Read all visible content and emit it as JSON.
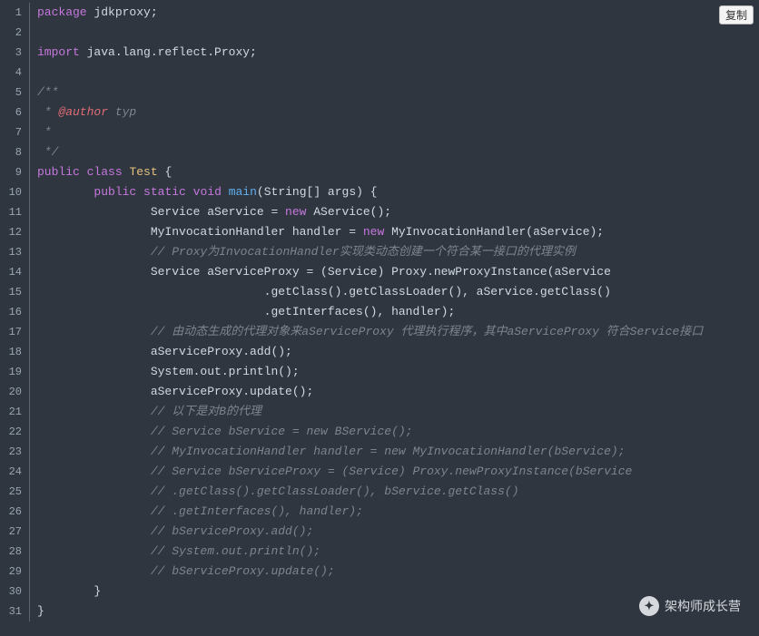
{
  "copy_button": "复制",
  "watermark": {
    "icon_glyph": "✦",
    "text": "架构师成长营"
  },
  "lines": [
    {
      "n": 1,
      "segs": [
        [
          "kw",
          "package"
        ],
        [
          "",
          " jdkproxy;"
        ]
      ]
    },
    {
      "n": 2,
      "segs": [
        [
          "",
          ""
        ]
      ]
    },
    {
      "n": 3,
      "segs": [
        [
          "kw",
          "import"
        ],
        [
          "",
          " java.lang.reflect.Proxy;"
        ]
      ]
    },
    {
      "n": 4,
      "segs": [
        [
          "",
          ""
        ]
      ]
    },
    {
      "n": 5,
      "segs": [
        [
          "com",
          "/**"
        ]
      ]
    },
    {
      "n": 6,
      "segs": [
        [
          "com",
          " * "
        ],
        [
          "tag",
          "@author"
        ],
        [
          "authv",
          " typ"
        ]
      ]
    },
    {
      "n": 7,
      "segs": [
        [
          "com",
          " *"
        ]
      ]
    },
    {
      "n": 8,
      "segs": [
        [
          "com",
          " */"
        ]
      ]
    },
    {
      "n": 9,
      "segs": [
        [
          "kw",
          "public"
        ],
        [
          "",
          " "
        ],
        [
          "kw",
          "class"
        ],
        [
          "",
          " "
        ],
        [
          "cls",
          "Test"
        ],
        [
          "",
          " {"
        ]
      ]
    },
    {
      "n": 10,
      "segs": [
        [
          "",
          "        "
        ],
        [
          "kw",
          "public"
        ],
        [
          "",
          " "
        ],
        [
          "kw",
          "static"
        ],
        [
          "",
          " "
        ],
        [
          "kw",
          "void"
        ],
        [
          "",
          " "
        ],
        [
          "fnname",
          "main"
        ],
        [
          "",
          "(String[] args) {"
        ]
      ]
    },
    {
      "n": 11,
      "segs": [
        [
          "",
          "                Service aService = "
        ],
        [
          "nw",
          "new"
        ],
        [
          "",
          " AService();"
        ]
      ]
    },
    {
      "n": 12,
      "segs": [
        [
          "",
          "                MyInvocationHandler handler = "
        ],
        [
          "nw",
          "new"
        ],
        [
          "",
          " MyInvocationHandler(aService);"
        ]
      ]
    },
    {
      "n": 13,
      "segs": [
        [
          "",
          "                "
        ],
        [
          "com",
          "// Proxy为InvocationHandler实现类动态创建一个符合某一接口的代理实例"
        ]
      ]
    },
    {
      "n": 14,
      "segs": [
        [
          "",
          "                Service aServiceProxy = (Service) Proxy.newProxyInstance(aService"
        ]
      ]
    },
    {
      "n": 15,
      "segs": [
        [
          "",
          "                                .getClass().getClassLoader(), aService.getClass()"
        ]
      ]
    },
    {
      "n": 16,
      "segs": [
        [
          "",
          "                                .getInterfaces(), handler);"
        ]
      ]
    },
    {
      "n": 17,
      "segs": [
        [
          "",
          "                "
        ],
        [
          "com",
          "// 由动态生成的代理对象来aServiceProxy 代理执行程序，其中aServiceProxy 符合Service接口"
        ]
      ]
    },
    {
      "n": 18,
      "segs": [
        [
          "",
          "                aServiceProxy.add();"
        ]
      ]
    },
    {
      "n": 19,
      "segs": [
        [
          "",
          "                System.out.println();"
        ]
      ]
    },
    {
      "n": 20,
      "segs": [
        [
          "",
          "                aServiceProxy.update();"
        ]
      ]
    },
    {
      "n": 21,
      "segs": [
        [
          "",
          "                "
        ],
        [
          "com",
          "// 以下是对B的代理"
        ]
      ]
    },
    {
      "n": 22,
      "segs": [
        [
          "",
          "                "
        ],
        [
          "com",
          "// Service bService = new BService();"
        ]
      ]
    },
    {
      "n": 23,
      "segs": [
        [
          "",
          "                "
        ],
        [
          "com",
          "// MyInvocationHandler handler = new MyInvocationHandler(bService);"
        ]
      ]
    },
    {
      "n": 24,
      "segs": [
        [
          "",
          "                "
        ],
        [
          "com",
          "// Service bServiceProxy = (Service) Proxy.newProxyInstance(bService"
        ]
      ]
    },
    {
      "n": 25,
      "segs": [
        [
          "",
          "                "
        ],
        [
          "com",
          "// .getClass().getClassLoader(), bService.getClass()"
        ]
      ]
    },
    {
      "n": 26,
      "segs": [
        [
          "",
          "                "
        ],
        [
          "com",
          "// .getInterfaces(), handler);"
        ]
      ]
    },
    {
      "n": 27,
      "segs": [
        [
          "",
          "                "
        ],
        [
          "com",
          "// bServiceProxy.add();"
        ]
      ]
    },
    {
      "n": 28,
      "segs": [
        [
          "",
          "                "
        ],
        [
          "com",
          "// System.out.println();"
        ]
      ]
    },
    {
      "n": 29,
      "segs": [
        [
          "",
          "                "
        ],
        [
          "com",
          "// bServiceProxy.update();"
        ]
      ]
    },
    {
      "n": 30,
      "segs": [
        [
          "",
          "        }"
        ]
      ]
    },
    {
      "n": 31,
      "segs": [
        [
          "",
          "}"
        ]
      ]
    }
  ]
}
